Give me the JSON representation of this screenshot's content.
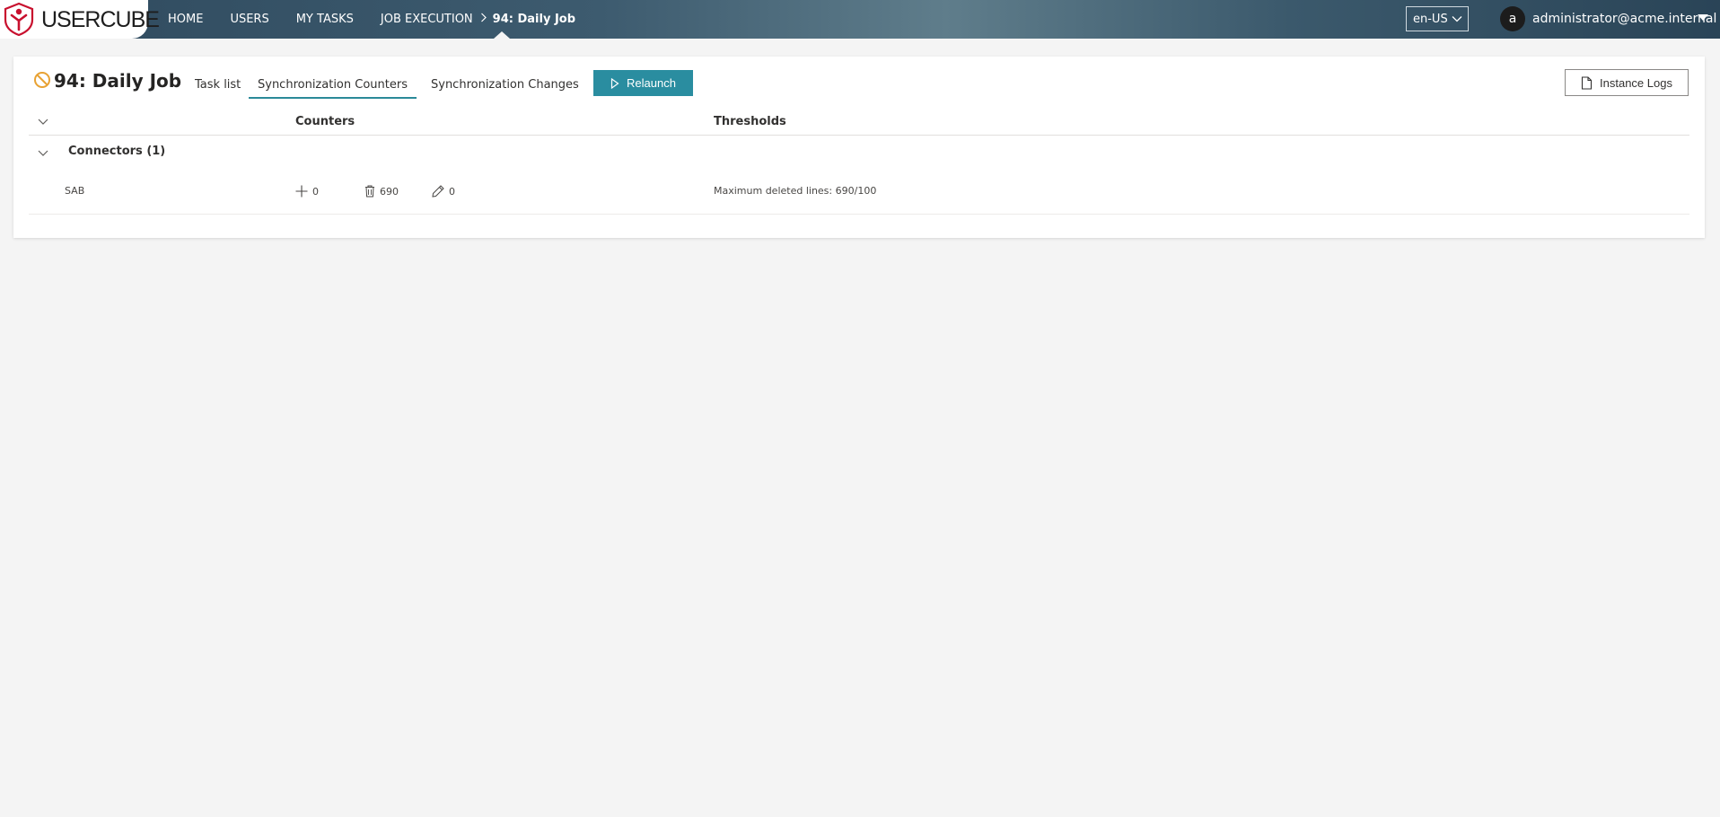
{
  "app": {
    "logo_text": "USERCUBE"
  },
  "nav": {
    "items": [
      "HOME",
      "USERS",
      "MY TASKS"
    ],
    "breadcrumb_parent": "JOB EXECUTION",
    "breadcrumb_separator": ">",
    "breadcrumb_current": "94: Daily Job"
  },
  "header": {
    "language": "en-US",
    "user_initial": "a",
    "user_email": "administrator@acme.internal"
  },
  "job": {
    "title": "94: Daily Job",
    "status_icon": "blocked-icon",
    "status_color": "#e8a234"
  },
  "tabs": [
    {
      "label": "Task list",
      "active": false
    },
    {
      "label": "Synchronization Counters",
      "active": true
    },
    {
      "label": "Synchronization Changes",
      "active": false
    }
  ],
  "actions": {
    "relaunch_label": "Relaunch",
    "instance_logs_label": "Instance Logs"
  },
  "table": {
    "columns": [
      "Counters",
      "Thresholds"
    ],
    "group_label": "Connectors (1)",
    "rows": [
      {
        "name": "SAB",
        "added": "0",
        "deleted": "690",
        "modified": "0",
        "threshold": "Maximum deleted lines: 690/100"
      }
    ]
  },
  "colors": {
    "accent": "#2a8da0",
    "tab_underline": "#2b8a99"
  }
}
